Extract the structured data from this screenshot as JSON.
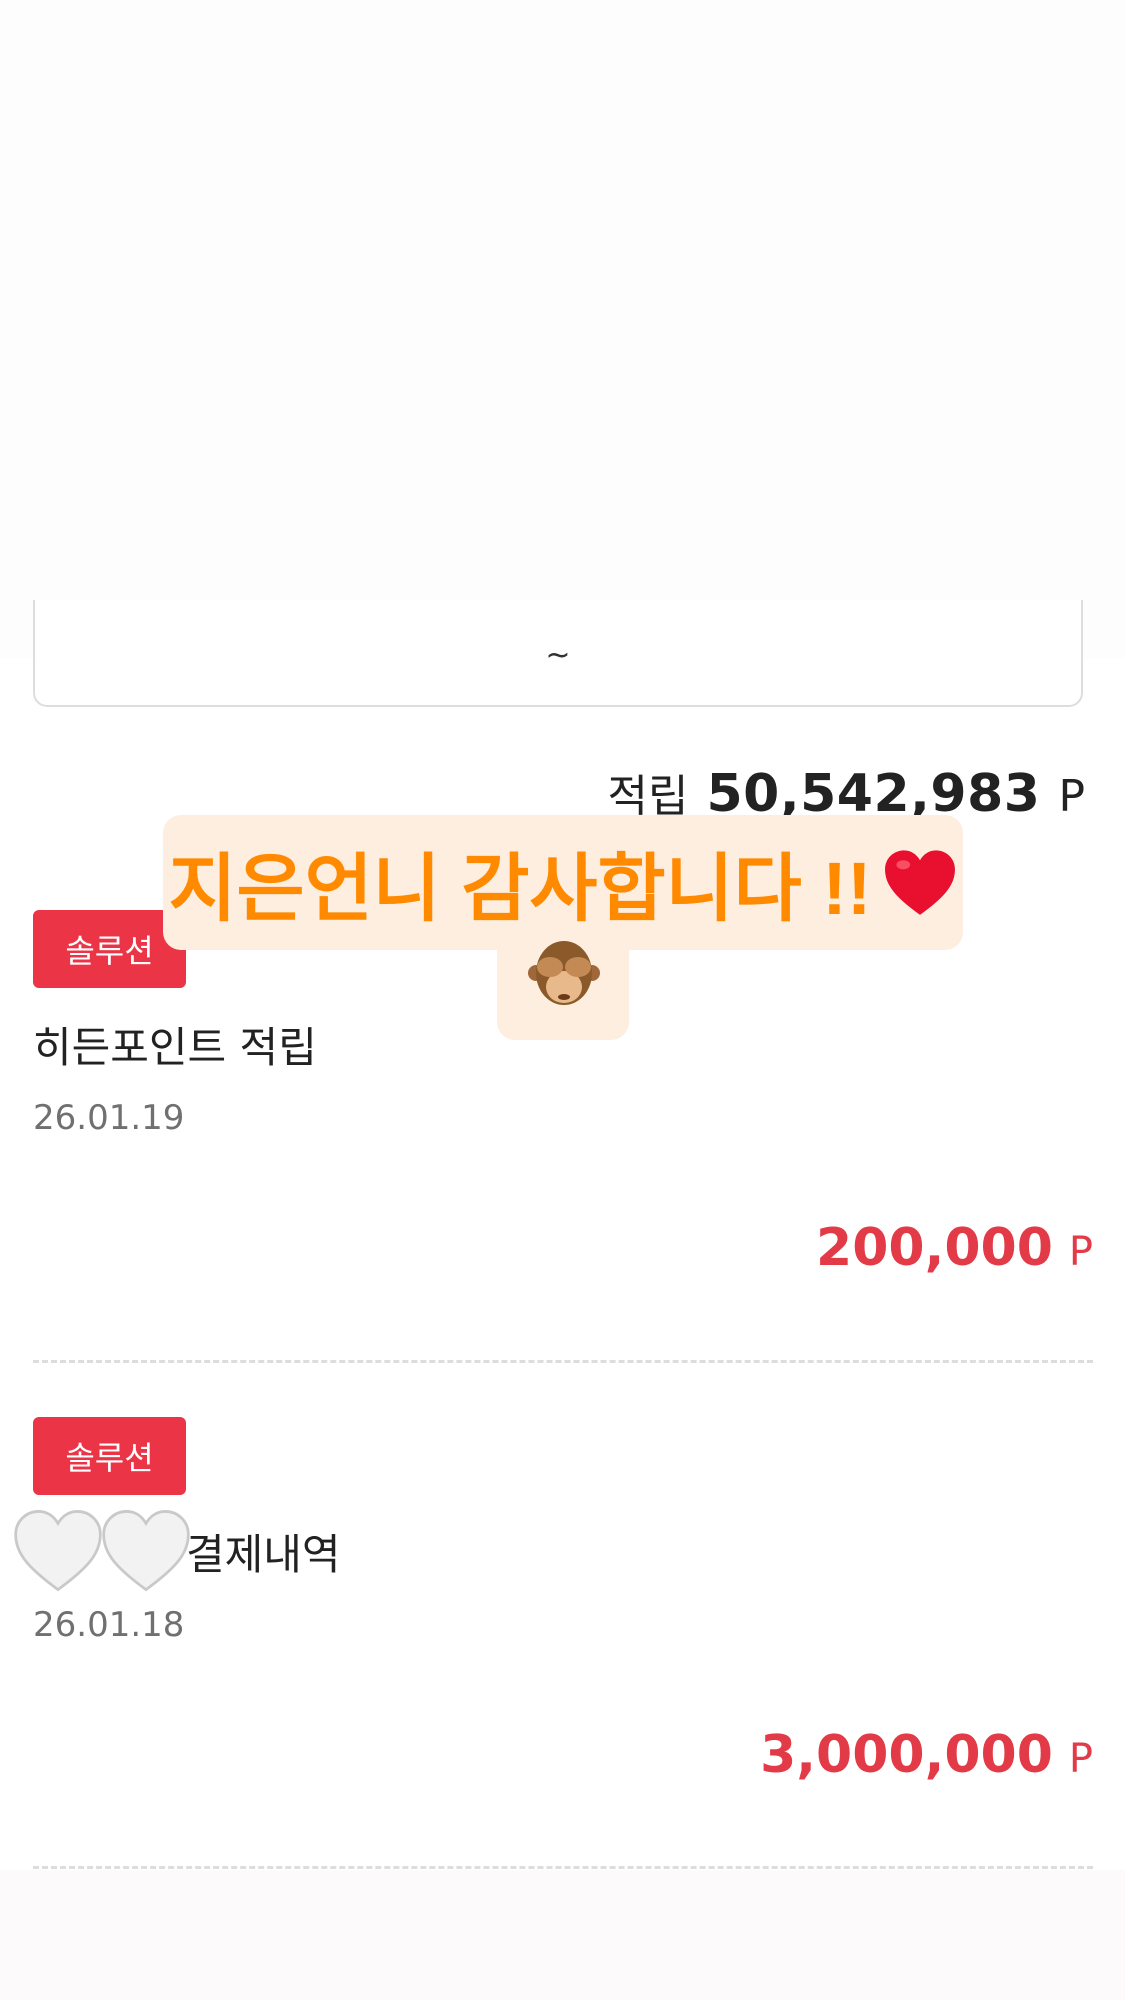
{
  "date_range": {
    "separator": "~"
  },
  "summary": {
    "label": "적립",
    "amount": "50,542,983",
    "unit": "P"
  },
  "story_overlay": {
    "text": "지은언니 감사합니다 !!",
    "emoji_heart": "heart-icon",
    "emoji_monkey": "see-no-evil-monkey-icon"
  },
  "history": [
    {
      "badge": "솔루션",
      "title": "히든포인트 적립",
      "date": "26.01.19",
      "amount": "200,000",
      "unit": "P"
    },
    {
      "badge": "솔루션",
      "title": "결제내역",
      "date": "26.01.18",
      "amount": "3,000,000",
      "unit": "P"
    }
  ],
  "colors": {
    "badge": "#ec3447",
    "amount": "#e23a47",
    "story_text": "#ff8a00",
    "story_bg": "#fdeee0"
  }
}
